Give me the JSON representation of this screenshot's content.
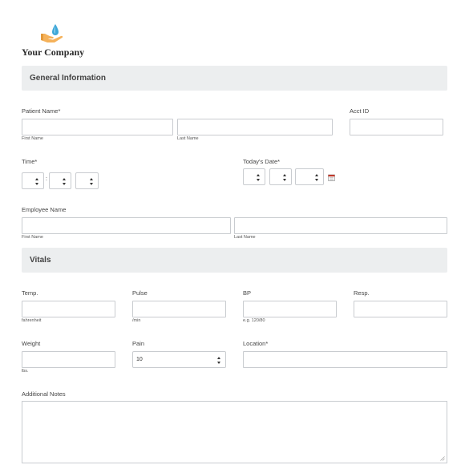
{
  "header": {
    "company": "Your Company",
    "logo_icon": "hand-water-drop-icon"
  },
  "general": {
    "title": "General Information",
    "patient_name_label": "Patient Name",
    "required_mark": "*",
    "first_name_sub": "First Name",
    "last_name_sub": "Last Name",
    "acct_id_label": "Acct ID",
    "time_label": "Time",
    "time_separator": ":",
    "todays_date_label": "Today's Date",
    "calendar_icon": "calendar-icon",
    "employee_name_label": "Employee Name"
  },
  "vitals": {
    "title": "Vitals",
    "temp_label": "Temp.",
    "temp_sub": "fahrenheit",
    "pulse_label": "Pulse",
    "pulse_sub": "/min",
    "bp_label": "BP",
    "bp_sub": "e.g. 120/80",
    "resp_label": "Resp.",
    "weight_label": "Weight",
    "weight_sub": "lbs.",
    "pain_label": "Pain",
    "pain_value": "10",
    "location_label": "Location",
    "notes_label": "Additional Notes"
  },
  "colors": {
    "section_bg": "#eceeef",
    "border": "#c9ccd0",
    "logo_hand": "#f5b25b",
    "logo_drop": "#3ea7d8"
  }
}
